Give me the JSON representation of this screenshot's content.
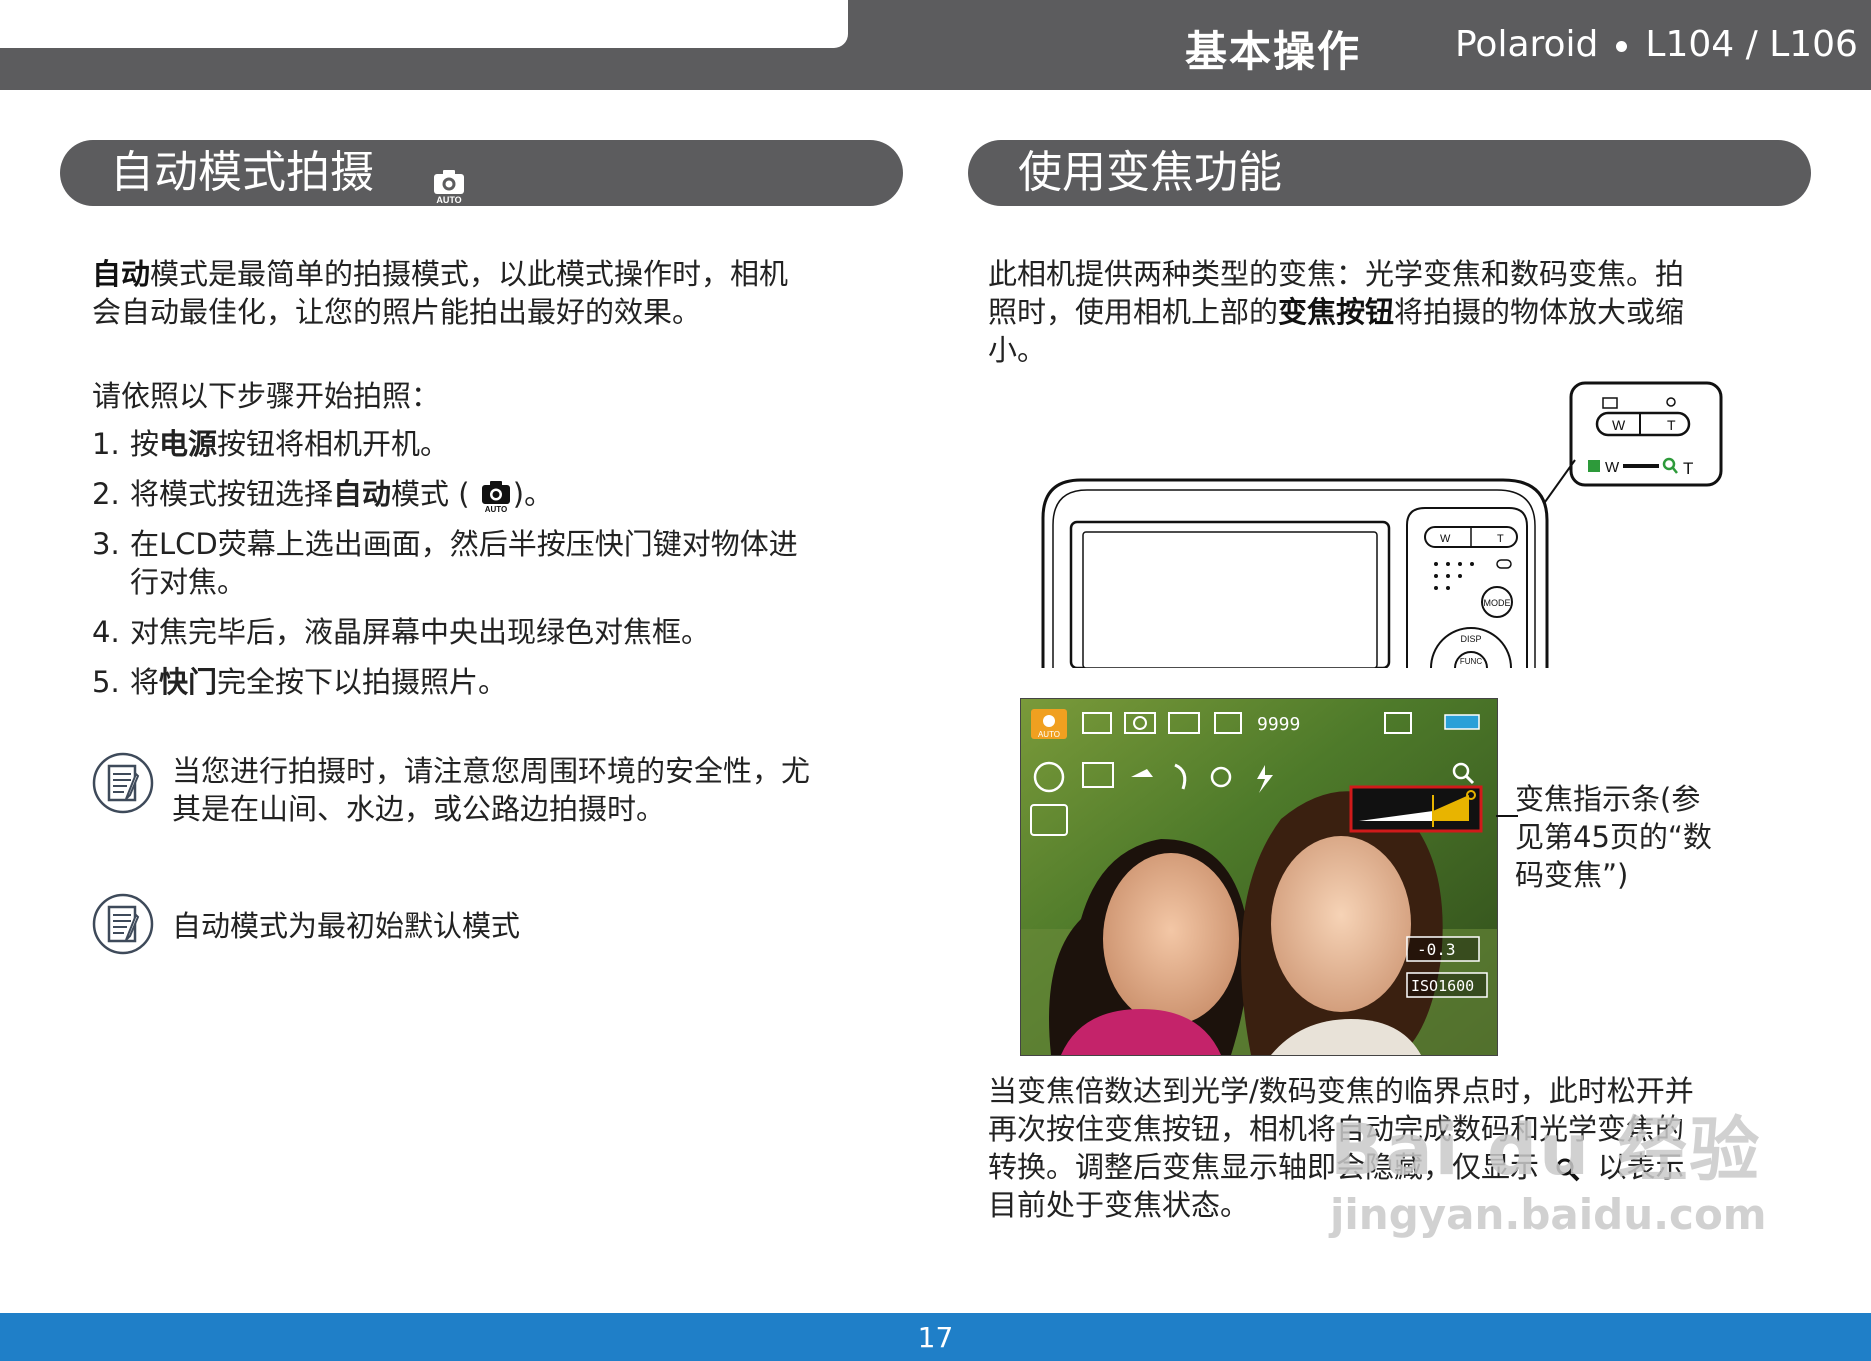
{
  "header": {
    "section_title": "基本操作",
    "brand": "Polaroid",
    "model": "L104 / L106"
  },
  "left": {
    "title": "自动模式拍摄",
    "title_icon": "camera-auto-icon",
    "intro_bold": "自动",
    "intro_line1_rest": "模式是最简单的拍摄模式，以此模式操作时，相机",
    "intro_line2": "会自动最佳化，让您的照片能拍出最好的效果。",
    "steps_heading": "请依照以下步骤开始拍照：",
    "steps": [
      {
        "num": "1.",
        "pre": "按",
        "bold": "电源",
        "post": "按钮将相机开机。"
      },
      {
        "num": "2.",
        "pre": "将模式按钮选择",
        "bold": "自动",
        "post": "模式 (",
        "tail": ")。"
      },
      {
        "num": "3.",
        "pre": "在LCD荧幕上选出画面，然后半按压快门键对物体进",
        "line2": "行对焦。"
      },
      {
        "num": "4.",
        "pre": "对焦完毕后，液晶屏幕中央出现绿色对焦框。"
      },
      {
        "num": "5.",
        "pre": "将",
        "bold": "快门",
        "post": "完全按下以拍摄照片。"
      }
    ],
    "note1_line1": "当您进行拍摄时，请注意您周围环境的安全性，尤",
    "note1_line2": "其是在山间、水边，或公路边拍摄时。",
    "note2": "自动模式为最初始默认模式",
    "auto_label": "AUTO"
  },
  "right": {
    "title": "使用变焦功能",
    "intro_line1": "此相机提供两种类型的变焦：光学变焦和数码变焦。拍",
    "intro_line2_pre": "照时，使用相机上部的",
    "intro_line2_bold": "变焦按钮",
    "intro_line2_post": "将拍摄的物体放大或缩",
    "intro_line3": "小。",
    "callout_line1": "变焦指示条(参",
    "callout_line2": "见第45页的“数",
    "callout_line3": "码变焦”)",
    "outro_line1": "当变焦倍数达到光学/数码变焦的临界点时，此时松开并",
    "outro_line2": "再次按住变焦按钮，相机将自动完成数码和光学变焦的",
    "outro_line3_pre": "转换。调整后变焦显示轴即会隐藏，仅显示",
    "outro_line3_post": "以表示",
    "outro_line4": "目前处于变焦状态。",
    "lcd": {
      "shots_remaining": "9999",
      "exposure": "-0.3",
      "iso": "ISO1600",
      "auto_label": "AUTO"
    },
    "zoom_labels": {
      "w": "W",
      "t": "T"
    },
    "camera_labels": {
      "mode": "MODE",
      "disp": "DISP",
      "func": "FUNC"
    }
  },
  "watermark": {
    "line1": "Bai du 经验",
    "line2": "jingyan.baidu.com"
  },
  "footer": {
    "page_number": "17"
  },
  "colors": {
    "header_gray": "#5c5c5e",
    "footer_blue": "#1f7fc8",
    "zoom_bar_yellow": "#e8b400",
    "zoom_frame_red": "#d01a1a"
  }
}
